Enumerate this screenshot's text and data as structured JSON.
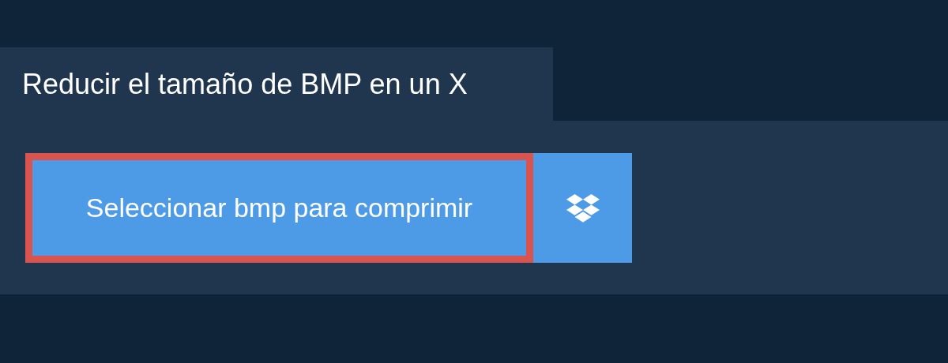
{
  "tab": {
    "label": "Reducir el tamaño de BMP en un X"
  },
  "buttons": [
    {
      "kind": "select",
      "label": "Seleccionar bmp para comprimir"
    },
    {
      "kind": "dropbox"
    }
  ]
}
